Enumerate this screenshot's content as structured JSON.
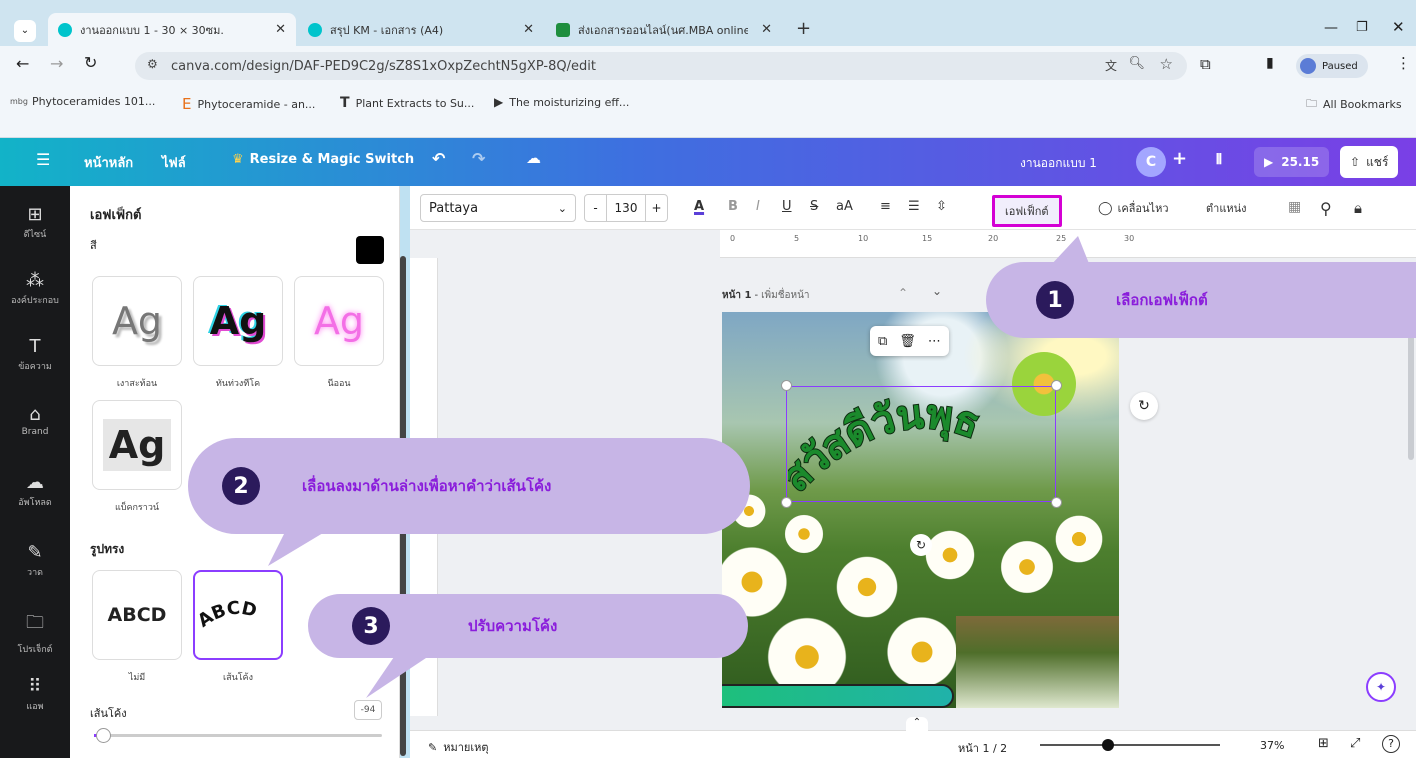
{
  "browser": {
    "tabs": [
      {
        "label": "งานออกแบบ 1 - 30 × 30ซม."
      },
      {
        "label": "สรุป KM - เอกสาร (A4)"
      },
      {
        "label": "ส่งเอกสารออนไลน์(นศ.MBA online"
      }
    ],
    "new_tab": "+",
    "url": "canva.com/design/DAF-PED9C2g/sZ8S1xOxpZechtN5gXP-8Q/edit",
    "profile_status": "Paused",
    "bookmarks": [
      {
        "label": "Phytoceramides 101..."
      },
      {
        "label": "Phytoceramide - an..."
      },
      {
        "label": "Plant Extracts to Su..."
      },
      {
        "label": "The moisturizing eff..."
      }
    ],
    "all_bookmarks": "All Bookmarks"
  },
  "canva_header": {
    "home": "หน้าหลัก",
    "file": "ไฟล์",
    "resize": "Resize & Magic Switch",
    "doc_title": "งานออกแบบ 1",
    "avatar_letter": "C",
    "timer": "25.15",
    "share": "แชร์"
  },
  "rail": {
    "items": [
      {
        "label": "ดีไซน์"
      },
      {
        "label": "องค์ประกอบ"
      },
      {
        "label": "ข้อความ"
      },
      {
        "label": "Brand"
      },
      {
        "label": "อัพโหลด"
      },
      {
        "label": "วาด"
      },
      {
        "label": "โปรเจ็กต์"
      },
      {
        "label": "แอพ"
      }
    ]
  },
  "panel": {
    "title": "เอฟเฟ็กต์",
    "color_label": "สี",
    "styles": [
      {
        "label": "เงาสะท้อน",
        "sample": "Ag"
      },
      {
        "label": "ทันท่วงทีโค",
        "sample": "Ag"
      },
      {
        "label": "นีออน",
        "sample": "Ag"
      },
      {
        "label": "แบ็คกราวน์",
        "sample": "Ag"
      }
    ],
    "shape_title": "รูปทรง",
    "shapes": [
      {
        "label": "ไม่มี",
        "sample": "ABCD"
      },
      {
        "label": "เส้นโค้ง",
        "sample": "ABCD"
      }
    ],
    "curve_label": "เส้นโค้ง",
    "curve_value": "-94",
    "curve_slider_fraction": 0.03
  },
  "toolbar": {
    "font": "Pattaya",
    "size": "130",
    "minus": "-",
    "plus": "+",
    "effects": "เอฟเฟ็กต์",
    "animate": "เคลื่อนไหว",
    "position": "ตำแหน่ง"
  },
  "canvas": {
    "page_label": "หน้า 1",
    "page_title_placeholder": "เพิ่มชื่อหน้า",
    "curved_text": "สวัสดีวันพุธ",
    "ruler_ticks": [
      "0",
      "5",
      "10",
      "15",
      "20",
      "25",
      "30"
    ]
  },
  "bottom": {
    "notes": "หมายเหตุ",
    "page_indicator": "หน้า 1 / 2",
    "zoom": "37%"
  },
  "callouts": [
    {
      "number": "1",
      "text": "เลือกเอฟเฟ็กต์"
    },
    {
      "number": "2",
      "text": "เลื่อนลงมาด้านล่างเพื่อหาคำว่าเส้นโค้ง"
    },
    {
      "number": "3",
      "text": "ปรับความโค้ง"
    }
  ],
  "colors": {
    "accent": "#8b3dff",
    "callout_bg": "#c7b5e6",
    "callout_text": "#8a1ddb",
    "highlight": "#d400d4"
  }
}
